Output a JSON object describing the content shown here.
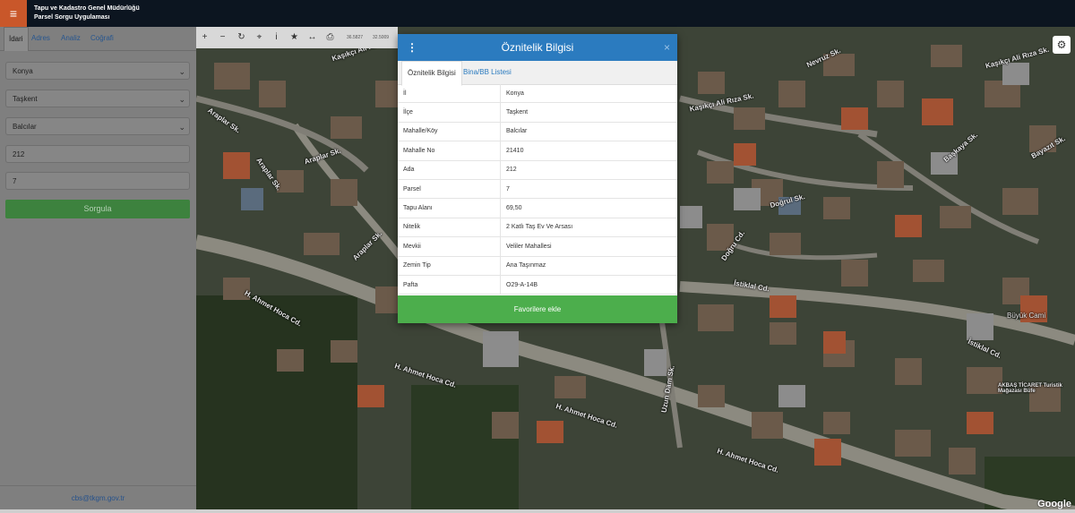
{
  "app": {
    "title_line1": "Tapu ve Kadastro Genel Müdürlüğü",
    "title_line2": "Parsel Sorgu Uygulaması",
    "menu_icon": "hamburger-icon"
  },
  "sidebar": {
    "tabs": [
      {
        "label": "İdari",
        "active": true
      },
      {
        "label": "Adres",
        "active": false
      },
      {
        "label": "Analiz",
        "active": false
      },
      {
        "label": "Coğrafi",
        "active": false
      }
    ],
    "il": "Konya",
    "ilce": "Taşkent",
    "mahalle": "Balcılar",
    "ada": "212",
    "parsel": "7",
    "sorgula_label": "Sorgula",
    "footer_email": "cbs@tkgm.gov.tr"
  },
  "map": {
    "coord_x": "36.5827",
    "coord_y": "32.5009",
    "attribution": "Google",
    "streets": [
      "Kaşıkçı Ali Rıza Sk.",
      "Kaşıkçı Ali Rıza Sk.",
      "Kaşıkçı Ali Rıza Sk.",
      "Nevruz Sk.",
      "Araplar Sk.",
      "Araplar Sk.",
      "Araplar Sk.",
      "Araplar Sk.",
      "H. Ahmet Hoca Cd.",
      "H. Ahmet Hoca Cd.",
      "H. Ahmet Hoca Cd.",
      "H. Ahmet Hoca Cd.",
      "Uzun Dam Sk.",
      "İstiklal Cd.",
      "İstiklal Cd.",
      "Doğru Cd.",
      "Doğrul Sk.",
      "Bayazıt Sk.",
      "Başkaya Sk.",
      "Büyük Cami",
      "AKBAŞ TİCARET Turistik Mağazası Büfe"
    ],
    "tools": [
      "plus-icon",
      "minus-icon",
      "refresh-icon",
      "crosshair-icon",
      "info-icon",
      "star-icon",
      "ruler-icon",
      "print-icon"
    ]
  },
  "modal": {
    "title": "Öznitelik Bilgisi",
    "close_label": "×",
    "tabs": [
      "Öznitelik Bilgisi",
      "Bina/BB Listesi"
    ],
    "rows": [
      {
        "key": "İl",
        "value": "Konya"
      },
      {
        "key": "İlçe",
        "value": "Taşkent"
      },
      {
        "key": "Mahalle/Köy",
        "value": "Balcılar"
      },
      {
        "key": "Mahalle No",
        "value": "21410"
      },
      {
        "key": "Ada",
        "value": "212"
      },
      {
        "key": "Parsel",
        "value": "7"
      },
      {
        "key": "Tapu Alanı",
        "value": "69,50"
      },
      {
        "key": "Nitelik",
        "value": "2 Katlı Taş Ev Ve Arsası"
      },
      {
        "key": "Mevkii",
        "value": "Veliler Mahallesi"
      },
      {
        "key": "Zemin Tip",
        "value": "Ana Taşınmaz"
      },
      {
        "key": "Pafta",
        "value": "O29-A-14B"
      }
    ],
    "favorite_label": "Favorilere ekle"
  },
  "colors": {
    "accent": "#2b7bbf",
    "menu": "#c9572a",
    "success": "#4cae4c"
  }
}
